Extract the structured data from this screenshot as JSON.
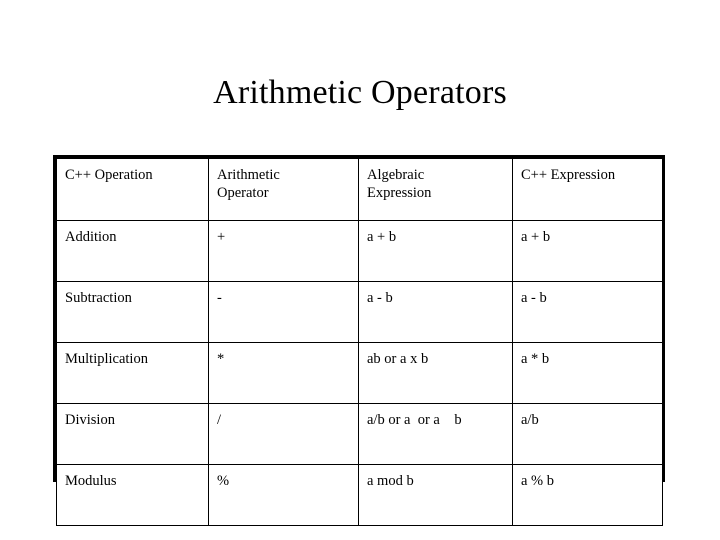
{
  "slide": {
    "title": "Arithmetic Operators",
    "background_color": "#ffffff",
    "text_color": "#000000"
  },
  "table": {
    "border_color": "#000000",
    "headers": [
      "C++ Operation",
      "Arithmetic\nOperator",
      "Algebraic\nExpression",
      "C++ Expression"
    ],
    "rows": [
      {
        "operation": "Addition",
        "operator": "+",
        "algebraic": "a + b",
        "expression": "a + b"
      },
      {
        "operation": "Subtraction",
        "operator": "-",
        "algebraic": "a - b",
        "expression": "a - b"
      },
      {
        "operation": "Multiplication",
        "operator": "*",
        "algebraic": "ab or a x b",
        "expression": "a * b"
      },
      {
        "operation": "Division",
        "operator": "/",
        "algebraic": "a/b or a  or a    b",
        "expression": "a/b"
      },
      {
        "operation": "Modulus",
        "operator": "%",
        "algebraic": "a mod b",
        "expression": "a % b"
      }
    ]
  }
}
